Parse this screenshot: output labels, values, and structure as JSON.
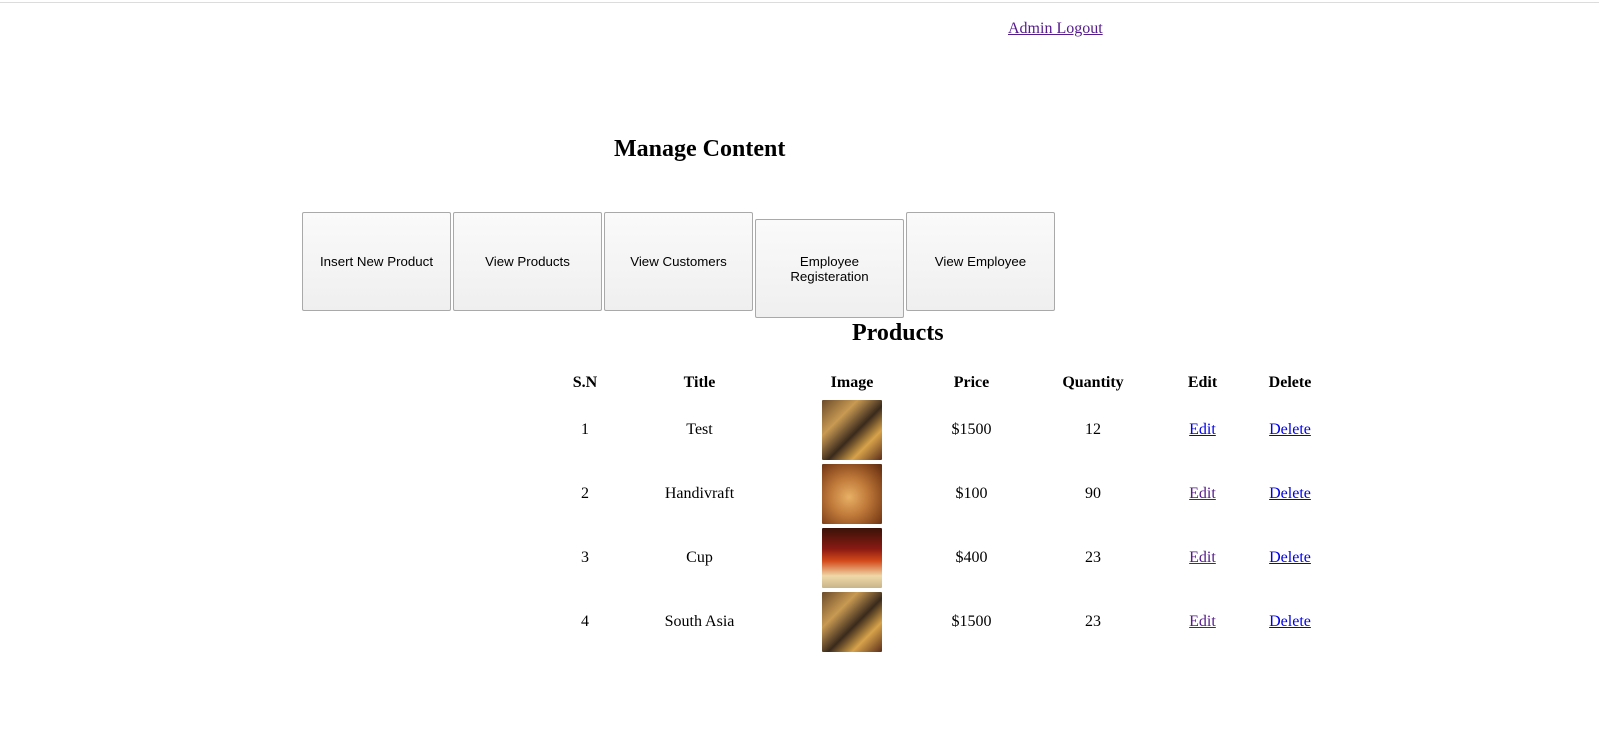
{
  "header": {
    "logout_label": "Admin Logout"
  },
  "manage": {
    "title": "Manage Content",
    "buttons": [
      {
        "label": "Insert New Product"
      },
      {
        "label": "View Products"
      },
      {
        "label": "View Customers"
      },
      {
        "label": "Employee Registeration"
      },
      {
        "label": "View Employee"
      }
    ]
  },
  "products": {
    "title": "Products",
    "columns": [
      "S.N",
      "Title",
      "Image",
      "Price",
      "Quantity",
      "Edit",
      "Delete"
    ],
    "rows": [
      {
        "sn": "1",
        "title": "Test",
        "price": "$1500",
        "quantity": "12",
        "edit": "Edit",
        "delete": "Delete",
        "image_icon": "product-thumbnail-image"
      },
      {
        "sn": "2",
        "title": "Handivraft",
        "price": "$100",
        "quantity": "90",
        "edit": "Edit",
        "delete": "Delete",
        "image_icon": "product-thumbnail-image"
      },
      {
        "sn": "3",
        "title": "Cup",
        "price": "$400",
        "quantity": "23",
        "edit": "Edit",
        "delete": "Delete",
        "image_icon": "product-thumbnail-image"
      },
      {
        "sn": "4",
        "title": "South Asia",
        "price": "$1500",
        "quantity": "23",
        "edit": "Edit",
        "delete": "Delete",
        "image_icon": "product-thumbnail-image"
      }
    ]
  },
  "colors": {
    "link": "#0000ee",
    "visited_link": "#551a8b",
    "button_border": "#a9a9a9"
  }
}
